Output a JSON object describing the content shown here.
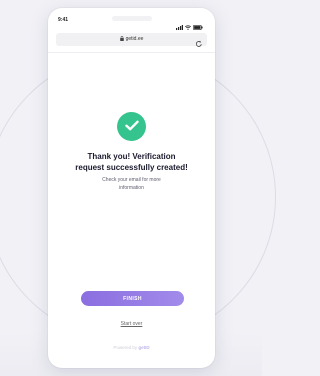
{
  "status_bar": {
    "time": "9:41",
    "icons": [
      "signal-icon",
      "wifi-icon",
      "battery-icon"
    ]
  },
  "browser": {
    "url": "getid.ee",
    "icons": [
      "lock-icon",
      "reload-icon"
    ]
  },
  "result": {
    "icon": "check-icon",
    "title_line1": "Thank you! Verification",
    "title_line2": "request successfully created!",
    "message_line1": "Check your email for more",
    "message_line2": "information"
  },
  "actions": {
    "finish_label": "FINISH",
    "start_over_label": "Start over"
  },
  "footer": {
    "powered_by": "Powered by",
    "brand": "getID"
  },
  "colors": {
    "accent": "#9b82e8",
    "success": "#36c48e",
    "background": "#f1f1f6"
  }
}
